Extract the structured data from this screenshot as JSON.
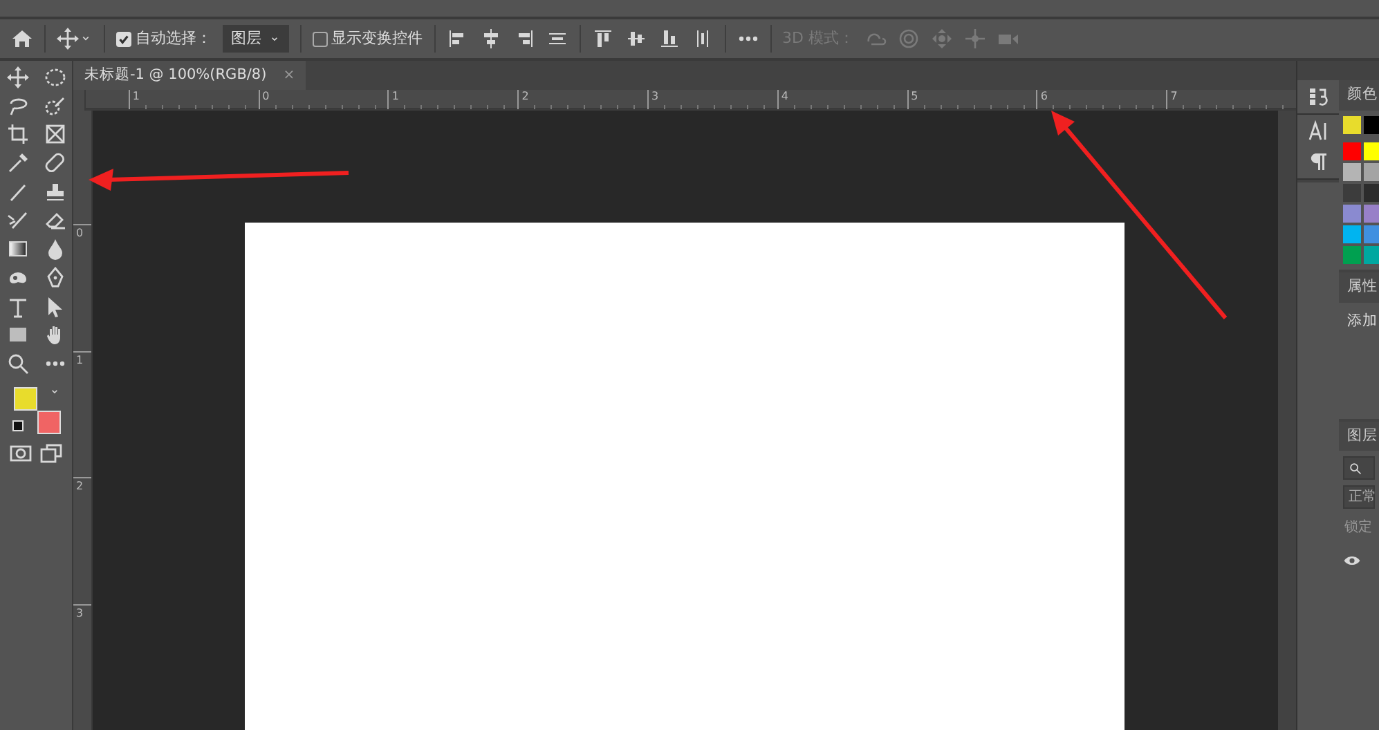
{
  "options_bar": {
    "auto_select": {
      "label": "自动选择：",
      "checked": true
    },
    "target_dropdown": {
      "value": "图层"
    },
    "show_transform_controls": {
      "label": "显示变换控件",
      "checked": false
    },
    "mode_3d": {
      "label": "3D 模式：",
      "disabled": true
    }
  },
  "document_tab": {
    "title": "未标题-1 @ 100%(RGB/8)",
    "close": "×",
    "selected": true
  },
  "rulers": {
    "horizontal": [
      "1",
      "0",
      "1",
      "2",
      "3",
      "4",
      "5",
      "6",
      "7"
    ],
    "vertical": [
      "0",
      "1",
      "2",
      "3"
    ]
  },
  "toolbar": {
    "color_chips": [
      {
        "kind": "foreground",
        "color": "#e8dc2c"
      },
      {
        "kind": "background",
        "color": "#f06464"
      }
    ]
  },
  "color_panel": {
    "title": "颜色",
    "swatches": [
      {
        "color": "#e8dc2c"
      },
      {
        "color": "#000000"
      },
      {
        "color": "#ff0000"
      },
      {
        "color": "#ffff00"
      },
      {
        "color": "#b4b4b4"
      },
      {
        "color": "#a4a4a4"
      },
      {
        "color": "#3c3c3c"
      },
      {
        "color": "#2c2c2c"
      },
      {
        "color": "#8a8ad0"
      },
      {
        "color": "#9880c8"
      },
      {
        "color": "#00b4f0"
      },
      {
        "color": "#4090e0"
      },
      {
        "color": "#00a050"
      },
      {
        "color": "#00a8a0"
      }
    ]
  },
  "properties_panel": {
    "title": "属性",
    "text": "添加"
  },
  "layers_panel": {
    "title": "图层",
    "blend_mode": "正常",
    "lock_label": "锁定"
  }
}
